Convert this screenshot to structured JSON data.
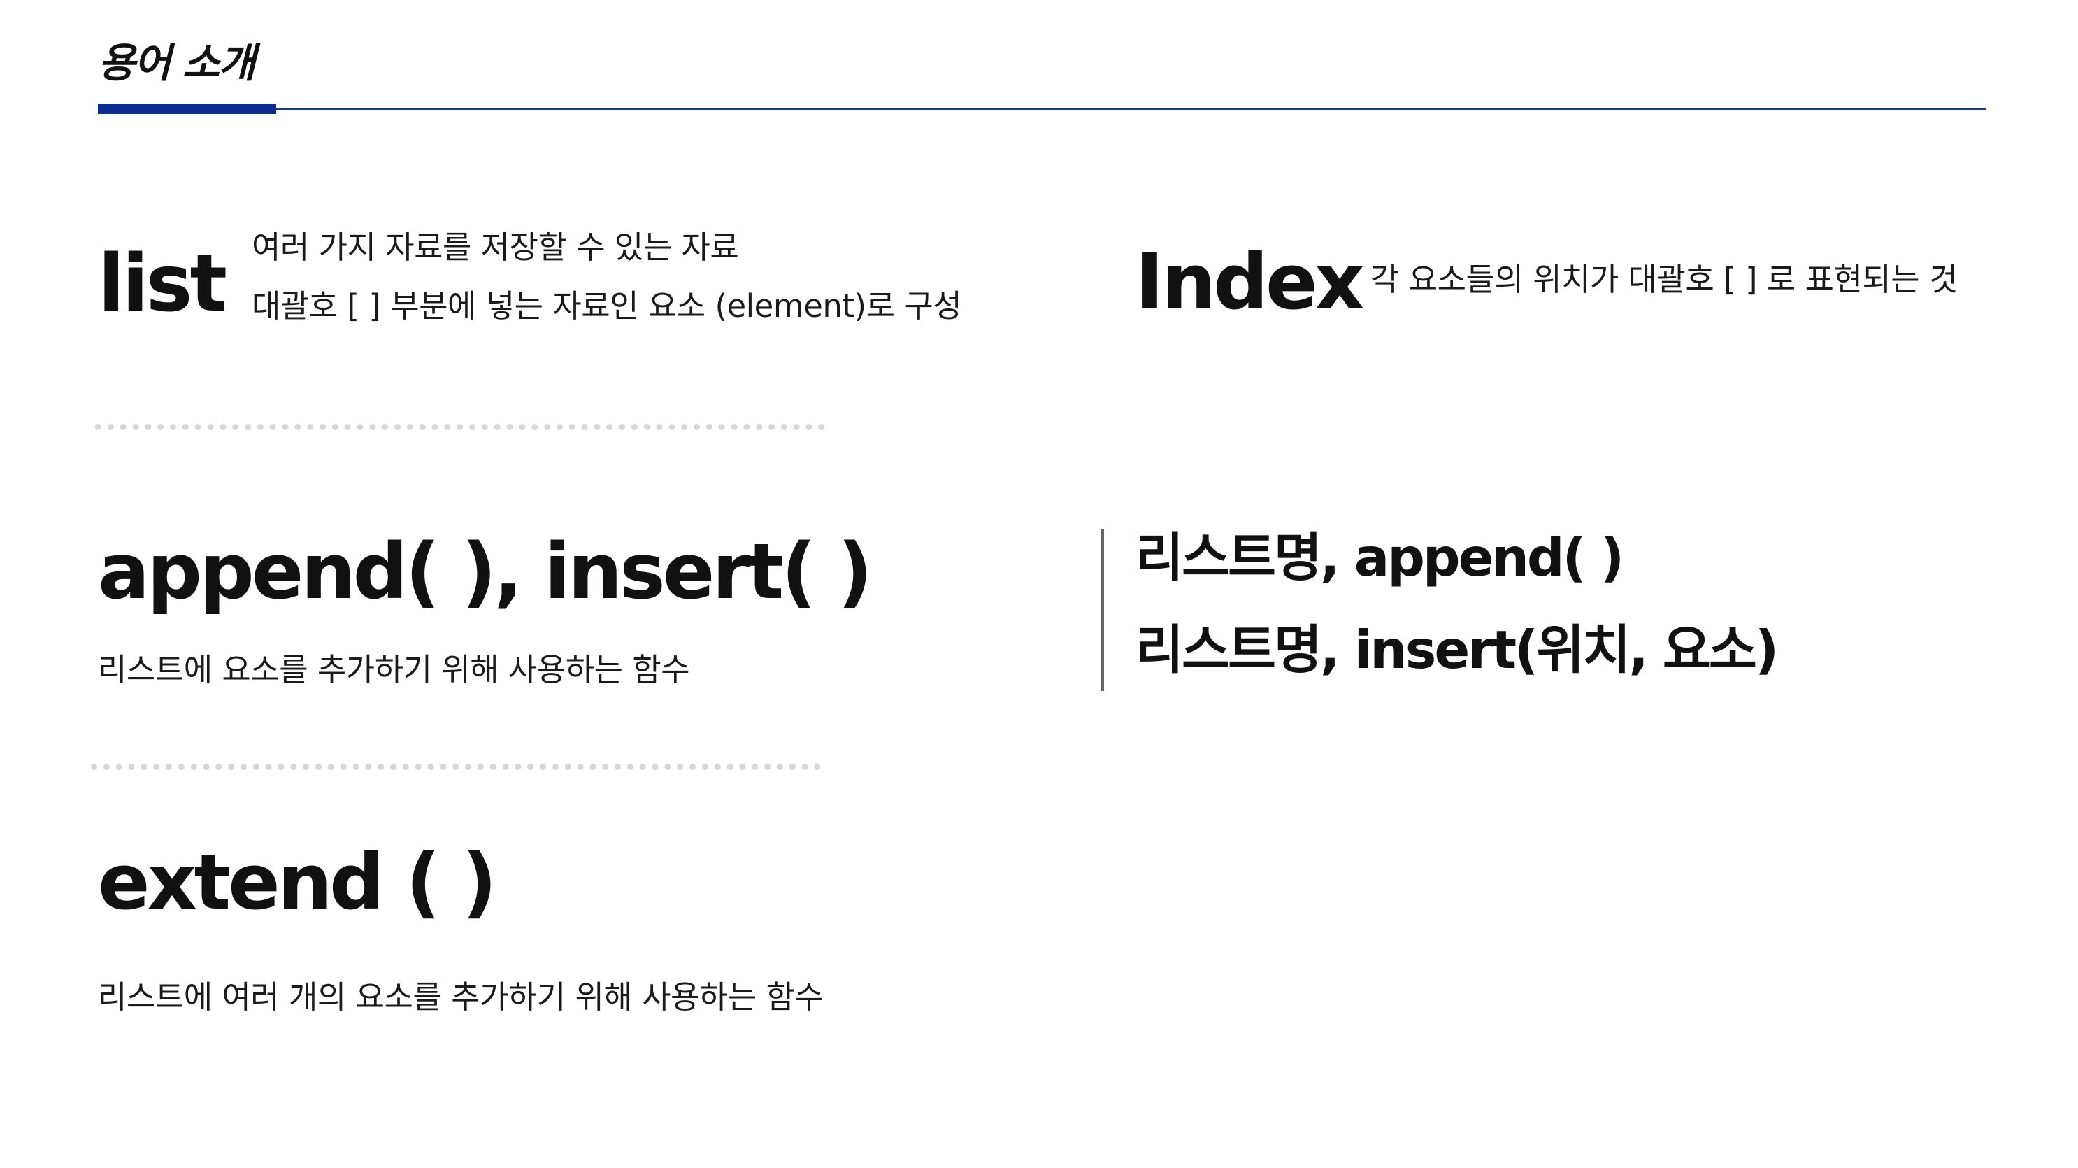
{
  "header": {
    "title": "용어 소개",
    "accent_color": "#0d2c8f"
  },
  "terms": {
    "list": {
      "name": "list",
      "desc_lines": [
        "여러 가지 자료를 저장할 수 있는 자료",
        "대괄호 [ ] 부분에 넣는 자료인 요소 (element)로 구성"
      ]
    },
    "index": {
      "name": "Index",
      "desc": "각 요소들의 위치가 대괄호 [ ] 로 표현되는 것"
    },
    "append_insert": {
      "name": "append( ), insert( )",
      "desc": "리스트에 요소를 추가하기 위해 사용하는 함수",
      "examples": [
        "리스트명, append( )",
        "리스트명, insert(위치, 요소)"
      ]
    },
    "extend": {
      "name": "extend ( )",
      "desc": "리스트에 여러 개의 요소를 추가하기 위해 사용하는 함수"
    }
  }
}
